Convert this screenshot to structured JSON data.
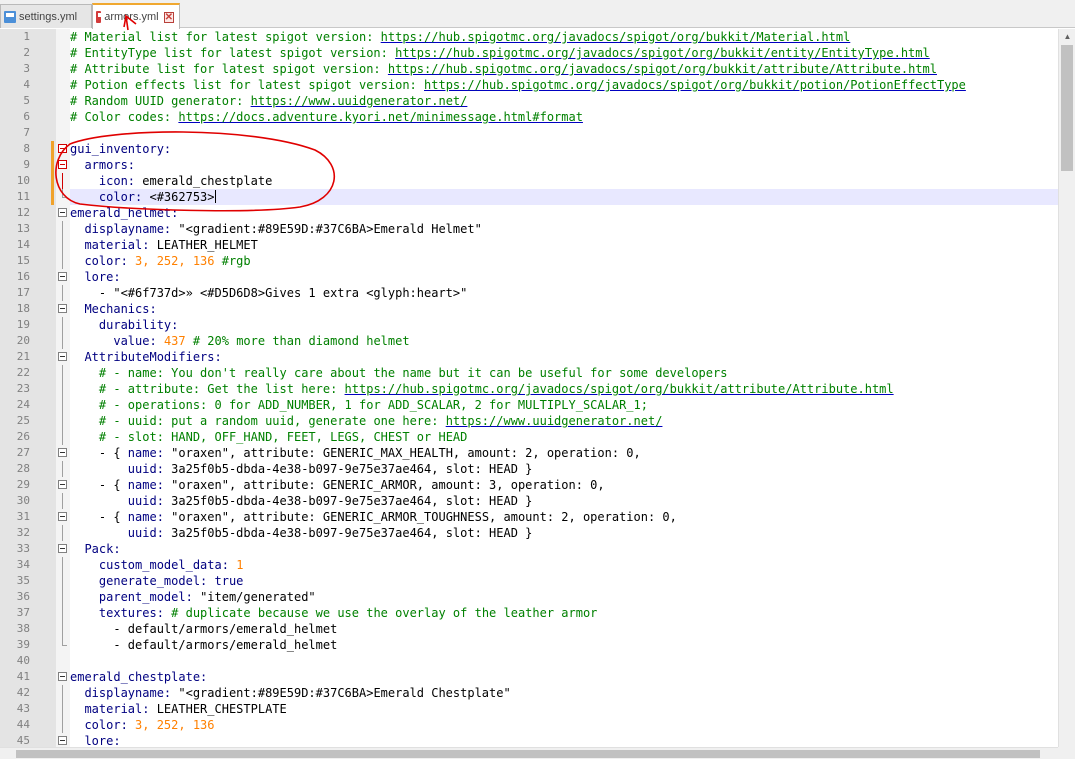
{
  "tabs": [
    {
      "label": "settings.yml",
      "icon": "yaml-file-icon",
      "active": false
    },
    {
      "label": "armors.yml",
      "icon": "yaml-file-icon",
      "active": true
    }
  ],
  "lines": [
    {
      "n": "1",
      "parts": [
        [
          "c",
          "# Material list for latest spigot version: "
        ],
        [
          "u",
          "https://hub.spigotmc.org/javadocs/spigot/org/bukkit/Material.html"
        ]
      ]
    },
    {
      "n": "2",
      "parts": [
        [
          "c",
          "# EntityType list for latest spigot version: "
        ],
        [
          "u",
          "https://hub.spigotmc.org/javadocs/spigot/org/bukkit/entity/EntityType.html"
        ]
      ]
    },
    {
      "n": "3",
      "parts": [
        [
          "c",
          "# Attribute list for latest spigot version: "
        ],
        [
          "u",
          "https://hub.spigotmc.org/javadocs/spigot/org/bukkit/attribute/Attribute.html"
        ]
      ]
    },
    {
      "n": "4",
      "parts": [
        [
          "c",
          "# Potion effects list for latest spigot version: "
        ],
        [
          "u",
          "https://hub.spigotmc.org/javadocs/spigot/org/bukkit/potion/PotionEffectType"
        ]
      ]
    },
    {
      "n": "5",
      "parts": [
        [
          "c",
          "# Random UUID generator: "
        ],
        [
          "u",
          "https://www.uuidgenerator.net/"
        ]
      ]
    },
    {
      "n": "6",
      "parts": [
        [
          "c",
          "# Color codes: "
        ],
        [
          "u",
          "https://docs.adventure.kyori.net/minimessage.html#format"
        ]
      ]
    },
    {
      "n": "7",
      "parts": []
    },
    {
      "n": "8",
      "parts": [
        [
          "k",
          "gui_inventory:"
        ]
      ]
    },
    {
      "n": "9",
      "parts": [
        [
          "s",
          "  "
        ],
        [
          "k",
          "armors:"
        ]
      ]
    },
    {
      "n": "10",
      "parts": [
        [
          "s",
          "    "
        ],
        [
          "k",
          "icon: "
        ],
        [
          "s",
          "emerald_chestplate"
        ]
      ]
    },
    {
      "n": "11",
      "parts": [
        [
          "s",
          "    "
        ],
        [
          "k",
          "color: "
        ],
        [
          "s",
          "<#362753>"
        ]
      ]
    },
    {
      "n": "12",
      "parts": [
        [
          "k",
          "emerald_helmet:"
        ]
      ]
    },
    {
      "n": "13",
      "parts": [
        [
          "s",
          "  "
        ],
        [
          "k",
          "displayname: "
        ],
        [
          "s",
          "\"<gradient:#89E59D:#37C6BA>Emerald Helmet\""
        ]
      ]
    },
    {
      "n": "14",
      "parts": [
        [
          "s",
          "  "
        ],
        [
          "k",
          "material: "
        ],
        [
          "s",
          "LEATHER_HELMET"
        ]
      ]
    },
    {
      "n": "15",
      "parts": [
        [
          "s",
          "  "
        ],
        [
          "k",
          "color: "
        ],
        [
          "n",
          "3, 252, 136 "
        ],
        [
          "c",
          "#rgb"
        ]
      ]
    },
    {
      "n": "16",
      "parts": [
        [
          "s",
          "  "
        ],
        [
          "k",
          "lore:"
        ]
      ]
    },
    {
      "n": "17",
      "parts": [
        [
          "s",
          "    - \"<#6f737d>» <#D5D6D8>Gives 1 extra <glyph:heart>\""
        ]
      ]
    },
    {
      "n": "18",
      "parts": [
        [
          "s",
          "  "
        ],
        [
          "k",
          "Mechanics:"
        ]
      ]
    },
    {
      "n": "19",
      "parts": [
        [
          "s",
          "    "
        ],
        [
          "k",
          "durability:"
        ]
      ]
    },
    {
      "n": "20",
      "parts": [
        [
          "s",
          "      "
        ],
        [
          "k",
          "value: "
        ],
        [
          "n",
          "437 "
        ],
        [
          "c",
          "# 20% more than diamond helmet"
        ]
      ]
    },
    {
      "n": "21",
      "parts": [
        [
          "s",
          "  "
        ],
        [
          "k",
          "AttributeModifiers:"
        ]
      ]
    },
    {
      "n": "22",
      "parts": [
        [
          "s",
          "    "
        ],
        [
          "c",
          "# - name: You don't really care about the name but it can be useful for some developers"
        ]
      ]
    },
    {
      "n": "23",
      "parts": [
        [
          "s",
          "    "
        ],
        [
          "c",
          "# - attribute: Get the list here: "
        ],
        [
          "u",
          "https://hub.spigotmc.org/javadocs/spigot/org/bukkit/attribute/Attribute.html"
        ]
      ]
    },
    {
      "n": "24",
      "parts": [
        [
          "s",
          "    "
        ],
        [
          "c",
          "# - operations: 0 for ADD_NUMBER, 1 for ADD_SCALAR, 2 for MULTIPLY_SCALAR_1;"
        ]
      ]
    },
    {
      "n": "25",
      "parts": [
        [
          "s",
          "    "
        ],
        [
          "c",
          "# - uuid: put a random uuid, generate one here: "
        ],
        [
          "u",
          "https://www.uuidgenerator.net/"
        ]
      ]
    },
    {
      "n": "26",
      "parts": [
        [
          "s",
          "    "
        ],
        [
          "c",
          "# - slot: HAND, OFF_HAND, FEET, LEGS, CHEST or HEAD"
        ]
      ]
    },
    {
      "n": "27",
      "parts": [
        [
          "s",
          "    - { "
        ],
        [
          "k",
          "name: "
        ],
        [
          "s",
          "\"oraxen\", attribute: GENERIC_MAX_HEALTH, amount: 2, operation: 0,"
        ]
      ]
    },
    {
      "n": "28",
      "parts": [
        [
          "s",
          "        "
        ],
        [
          "k",
          "uuid: "
        ],
        [
          "s",
          "3a25f0b5-dbda-4e38-b097-9e75e37ae464, slot: HEAD }"
        ]
      ]
    },
    {
      "n": "29",
      "parts": [
        [
          "s",
          "    - { "
        ],
        [
          "k",
          "name: "
        ],
        [
          "s",
          "\"oraxen\", attribute: GENERIC_ARMOR, amount: 3, operation: 0,"
        ]
      ]
    },
    {
      "n": "30",
      "parts": [
        [
          "s",
          "        "
        ],
        [
          "k",
          "uuid: "
        ],
        [
          "s",
          "3a25f0b5-dbda-4e38-b097-9e75e37ae464, slot: HEAD }"
        ]
      ]
    },
    {
      "n": "31",
      "parts": [
        [
          "s",
          "    - { "
        ],
        [
          "k",
          "name: "
        ],
        [
          "s",
          "\"oraxen\", attribute: GENERIC_ARMOR_TOUGHNESS, amount: 2, operation: 0,"
        ]
      ]
    },
    {
      "n": "32",
      "parts": [
        [
          "s",
          "        "
        ],
        [
          "k",
          "uuid: "
        ],
        [
          "s",
          "3a25f0b5-dbda-4e38-b097-9e75e37ae464, slot: HEAD }"
        ]
      ]
    },
    {
      "n": "33",
      "parts": [
        [
          "s",
          "  "
        ],
        [
          "k",
          "Pack:"
        ]
      ]
    },
    {
      "n": "34",
      "parts": [
        [
          "s",
          "    "
        ],
        [
          "k",
          "custom_model_data: "
        ],
        [
          "n",
          "1"
        ]
      ]
    },
    {
      "n": "35",
      "parts": [
        [
          "s",
          "    "
        ],
        [
          "k",
          "generate_model: "
        ],
        [
          "k",
          "true"
        ]
      ]
    },
    {
      "n": "36",
      "parts": [
        [
          "s",
          "    "
        ],
        [
          "k",
          "parent_model: "
        ],
        [
          "s",
          "\"item/generated\""
        ]
      ]
    },
    {
      "n": "37",
      "parts": [
        [
          "s",
          "    "
        ],
        [
          "k",
          "textures: "
        ],
        [
          "c",
          "# duplicate because we use the overlay of the leather armor"
        ]
      ]
    },
    {
      "n": "38",
      "parts": [
        [
          "s",
          "      - default/armors/emerald_helmet"
        ]
      ]
    },
    {
      "n": "39",
      "parts": [
        [
          "s",
          "      - default/armors/emerald_helmet"
        ]
      ]
    },
    {
      "n": "40",
      "parts": []
    },
    {
      "n": "41",
      "parts": [
        [
          "k",
          "emerald_chestplate:"
        ]
      ]
    },
    {
      "n": "42",
      "parts": [
        [
          "s",
          "  "
        ],
        [
          "k",
          "displayname: "
        ],
        [
          "s",
          "\"<gradient:#89E59D:#37C6BA>Emerald Chestplate\""
        ]
      ]
    },
    {
      "n": "43",
      "parts": [
        [
          "s",
          "  "
        ],
        [
          "k",
          "material: "
        ],
        [
          "s",
          "LEATHER_CHESTPLATE"
        ]
      ]
    },
    {
      "n": "44",
      "parts": [
        [
          "s",
          "  "
        ],
        [
          "k",
          "color: "
        ],
        [
          "n",
          "3, 252, 136"
        ]
      ]
    },
    {
      "n": "45",
      "parts": [
        [
          "s",
          "  "
        ],
        [
          "k",
          "lore:"
        ]
      ]
    }
  ],
  "current_line": 11,
  "colors": {
    "comment": "#008000",
    "keyword": "#000080",
    "number": "#ff8000",
    "url_underline": "#0000c0",
    "current_line_bg": "#e8e8ff",
    "annotation": "#e00000",
    "change_bar": "#f0a22a"
  }
}
